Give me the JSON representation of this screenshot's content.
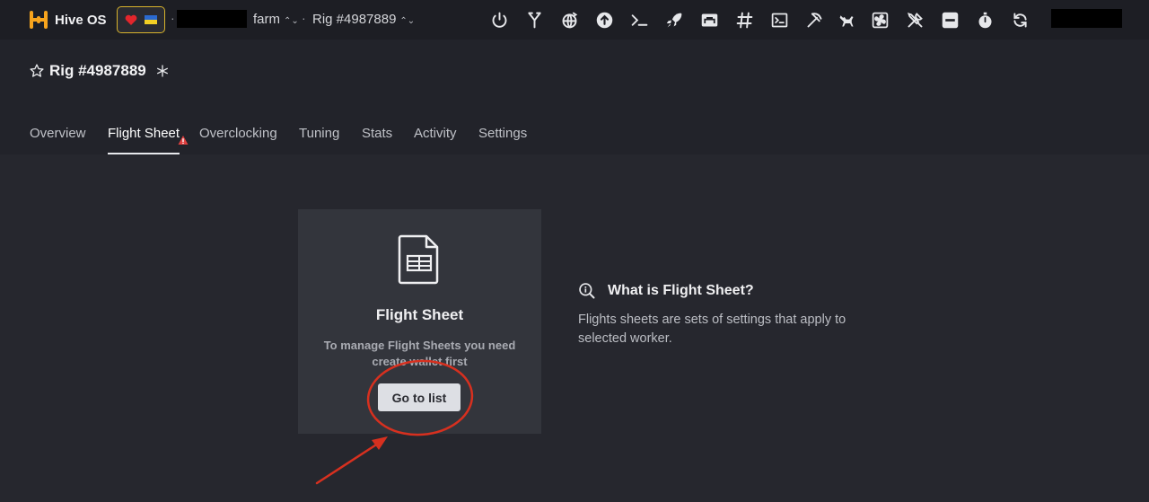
{
  "brand": {
    "name": "Hive OS"
  },
  "header": {
    "farm_label": "farm",
    "rig_crumb": "Rig #4987889",
    "tools": [
      {
        "icon": "power-icon"
      },
      {
        "icon": "fork-icon"
      },
      {
        "icon": "globe-refresh-icon"
      },
      {
        "icon": "upload-arrow-icon"
      },
      {
        "icon": "terminal-prompt-icon"
      },
      {
        "icon": "rocket-icon"
      },
      {
        "icon": "ethernet-icon"
      },
      {
        "icon": "hash-icon"
      },
      {
        "icon": "console-box-icon"
      },
      {
        "icon": "pickaxe-icon"
      },
      {
        "icon": "watchdog-icon"
      },
      {
        "icon": "fan-icon"
      },
      {
        "icon": "tools-icon"
      },
      {
        "icon": "minus-box-icon"
      },
      {
        "icon": "stopwatch-icon"
      },
      {
        "icon": "refresh-icon"
      }
    ]
  },
  "page": {
    "title": "Rig #4987889"
  },
  "tabs": [
    "Overview",
    "Flight Sheet",
    "Overclocking",
    "Tuning",
    "Stats",
    "Activity",
    "Settings"
  ],
  "active_tab": "Flight Sheet",
  "card": {
    "title": "Flight Sheet",
    "text": "To manage Flight Sheets you need create wallet first",
    "button": "Go to list"
  },
  "info": {
    "title": "What is Flight Sheet?",
    "text": "Flights sheets are sets of settings that apply to selected worker."
  },
  "colors": {
    "background": "#22232a",
    "topbar": "#1d1e24",
    "card": "#33353c",
    "annotation": "#d7301f",
    "warning": "#e04040",
    "brand_orange": "#f7a41d"
  }
}
